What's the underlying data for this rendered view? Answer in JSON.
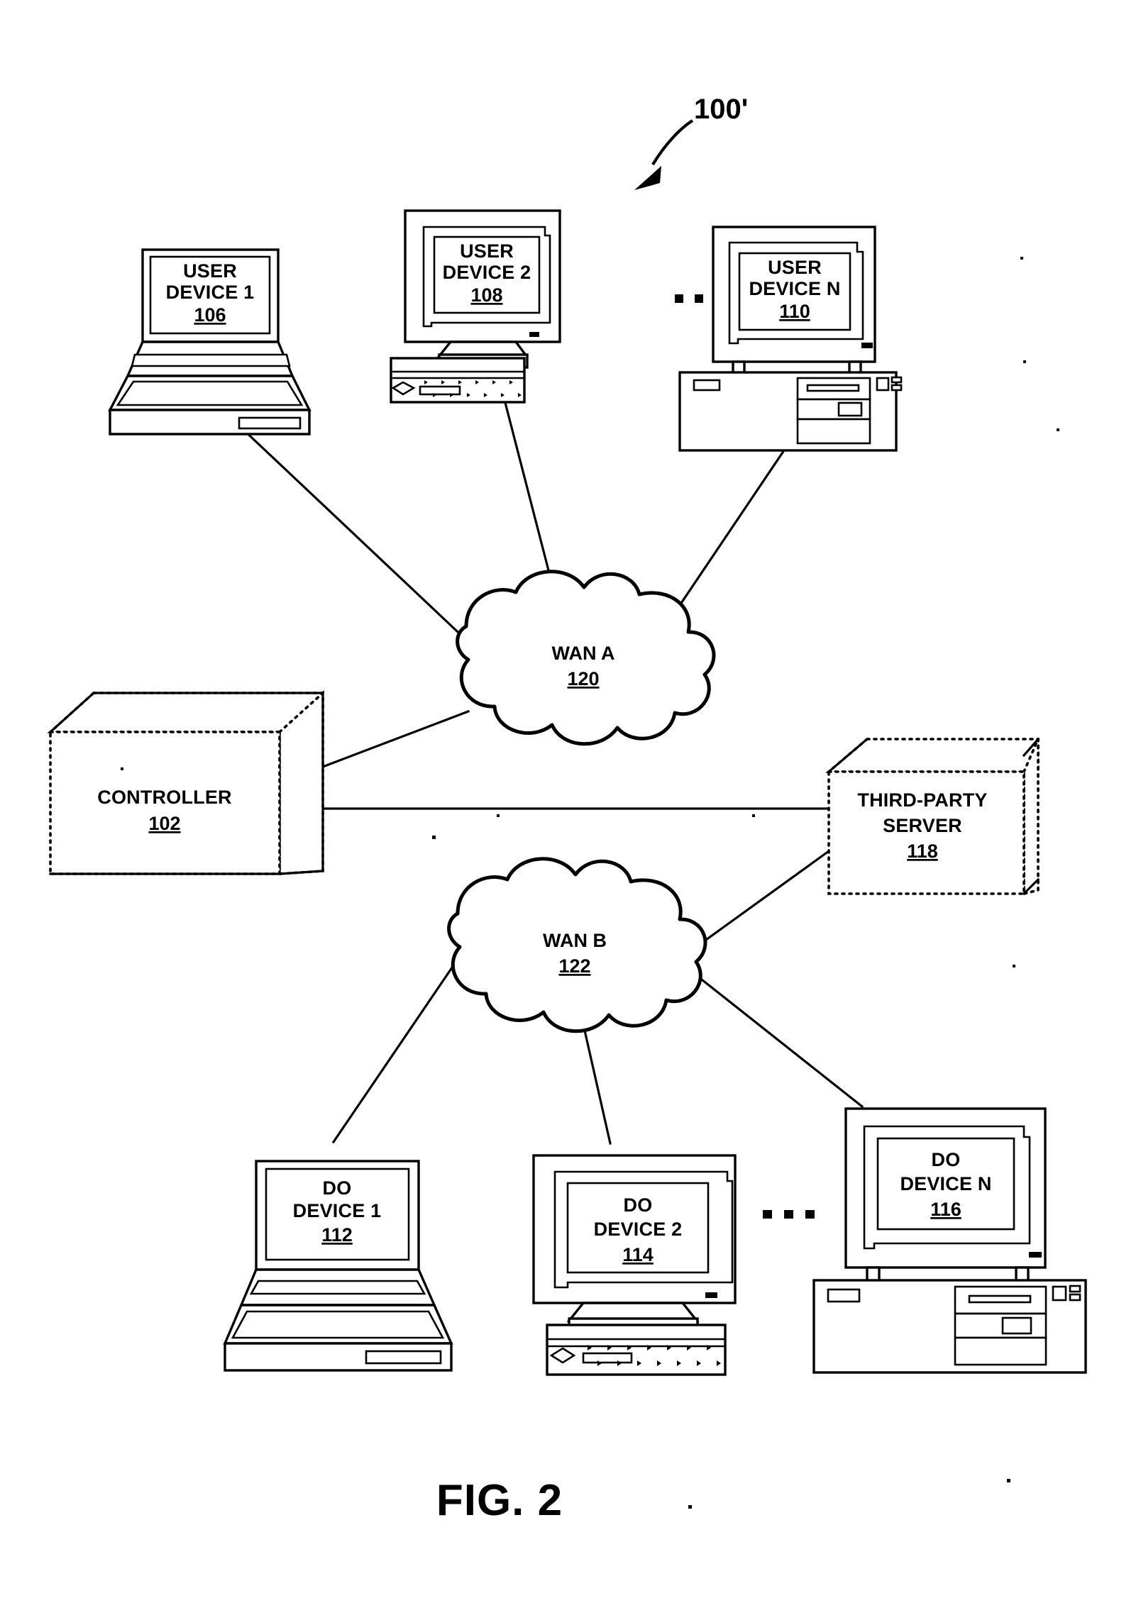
{
  "figure": {
    "caption": "FIG. 2",
    "reference_numeral": "100'"
  },
  "nodes": {
    "user_device_1": {
      "line1": "USER",
      "line2": "DEVICE 1",
      "num": "106",
      "type": "laptop"
    },
    "user_device_2": {
      "line1": "USER",
      "line2": "DEVICE 2",
      "num": "108",
      "type": "crt-monitor"
    },
    "user_device_n": {
      "line1": "USER",
      "line2": "DEVICE N",
      "num": "110",
      "type": "desktop-pc"
    },
    "controller": {
      "line1": "CONTROLLER",
      "line2": "",
      "num": "102",
      "type": "box-3d"
    },
    "third_party_server": {
      "line1": "THIRD-PARTY",
      "line2": "SERVER",
      "num": "118",
      "type": "box-3d"
    },
    "wan_a": {
      "line1": "WAN A",
      "num": "120",
      "type": "cloud"
    },
    "wan_b": {
      "line1": "WAN B",
      "num": "122",
      "type": "cloud"
    },
    "do_device_1": {
      "line1": "DO",
      "line2": "DEVICE 1",
      "num": "112",
      "type": "laptop"
    },
    "do_device_2": {
      "line1": "DO",
      "line2": "DEVICE 2",
      "num": "114",
      "type": "crt-monitor"
    },
    "do_device_n": {
      "line1": "DO",
      "line2": "DEVICE N",
      "num": "116",
      "type": "desktop-pc"
    }
  },
  "ellipsis": {
    "top": "...",
    "bottom": "..."
  },
  "colors": {
    "ink": "#000000",
    "paper": "#ffffff"
  }
}
